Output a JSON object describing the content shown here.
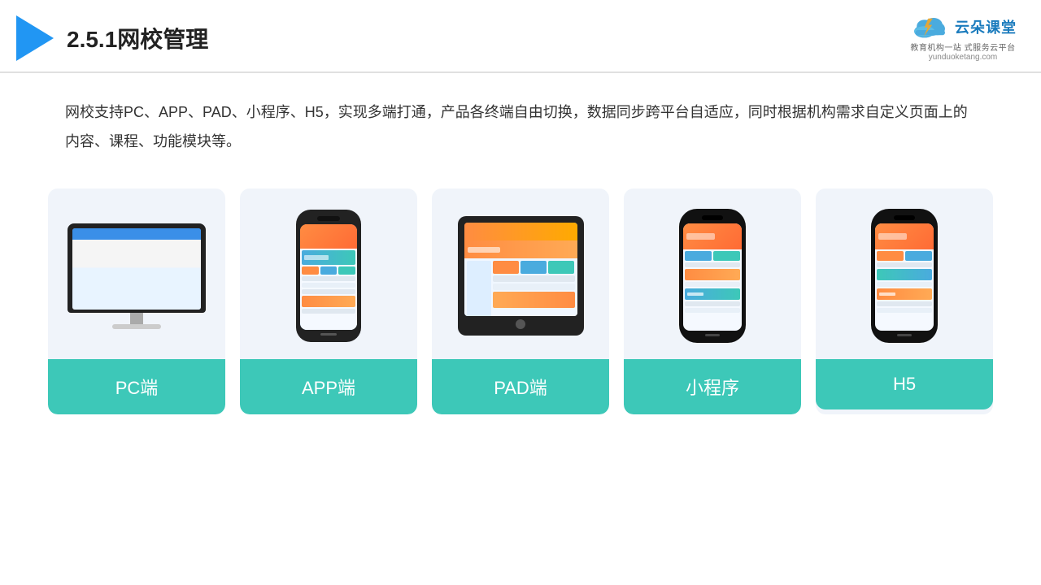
{
  "header": {
    "title": "2.5.1网校管理",
    "logo_text": "云朵课堂",
    "logo_sub1": "教育机构一站",
    "logo_sub2": "式服务云平台",
    "logo_url": "yunduoketang.com"
  },
  "description": {
    "text": "网校支持PC、APP、PAD、小程序、H5，实现多端打通，产品各终端自由切换，数据同步跨平台自适应，同时根据机构需求自定义页面上的内容、课程、功能模块等。"
  },
  "cards": [
    {
      "label": "PC端",
      "type": "pc"
    },
    {
      "label": "APP端",
      "type": "phone"
    },
    {
      "label": "PAD端",
      "type": "tablet"
    },
    {
      "label": "小程序",
      "type": "miniphone"
    },
    {
      "label": "H5",
      "type": "miniphone2"
    }
  ]
}
